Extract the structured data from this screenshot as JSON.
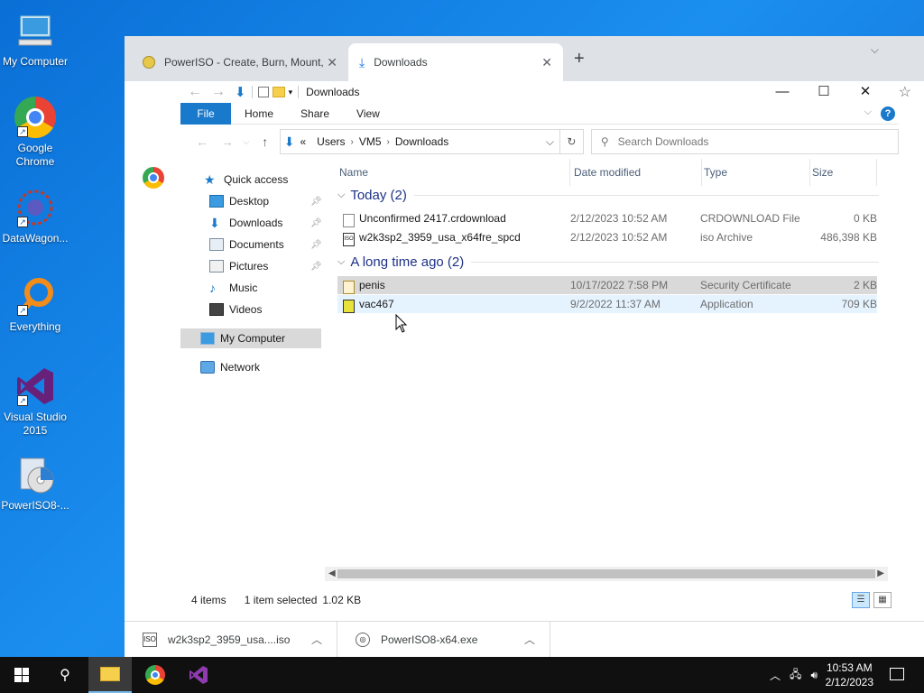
{
  "desktop": {
    "icons": [
      {
        "label": "My Computer"
      },
      {
        "label": "Google Chrome"
      },
      {
        "label": "DataWagon..."
      },
      {
        "label": "Everything"
      },
      {
        "label": "Visual Studio 2015"
      },
      {
        "label": "PowerISO8-..."
      }
    ]
  },
  "browser": {
    "tabs": [
      {
        "title": "PowerISO - Create, Burn, Mount,",
        "close": "✕"
      },
      {
        "title": "Downloads",
        "close": "✕"
      }
    ],
    "newtab": "+",
    "dropdown": "⌵",
    "star": "☆"
  },
  "explorer": {
    "title": "Downloads",
    "ribbon": {
      "file": "File",
      "tabs": [
        "Home",
        "Share",
        "View"
      ],
      "help": "?"
    },
    "address": {
      "overflow": "«",
      "crumbs": [
        "Users",
        "VM5",
        "Downloads"
      ]
    },
    "search_placeholder": "Search Downloads",
    "nav": [
      {
        "label": "Quick access"
      },
      {
        "label": "Desktop"
      },
      {
        "label": "Downloads"
      },
      {
        "label": "Documents"
      },
      {
        "label": "Pictures"
      },
      {
        "label": "Music"
      },
      {
        "label": "Videos"
      },
      {
        "label": "My Computer"
      },
      {
        "label": "Network"
      }
    ],
    "columns": {
      "name": "Name",
      "date": "Date modified",
      "type": "Type",
      "size": "Size"
    },
    "groups": [
      {
        "label": "Today (2)",
        "files": [
          {
            "name": "Unconfirmed 2417.crdownload",
            "date": "2/12/2023 10:52 AM",
            "type": "CRDOWNLOAD File",
            "size": "0 KB"
          },
          {
            "name": "w2k3sp2_3959_usa_x64fre_spcd",
            "date": "2/12/2023 10:52 AM",
            "type": "iso Archive",
            "size": "486,398 KB"
          }
        ]
      },
      {
        "label": "A long time ago (2)",
        "files": [
          {
            "name": "penis",
            "date": "10/17/2022 7:58 PM",
            "type": "Security Certificate",
            "size": "2 KB"
          },
          {
            "name": "vac467",
            "date": "9/2/2022 11:37 AM",
            "type": "Application",
            "size": "709 KB"
          }
        ]
      }
    ],
    "status": {
      "items": "4 items",
      "selected": "1 item selected",
      "size": "1.02 KB"
    }
  },
  "downloads_bar": [
    {
      "name": "w2k3sp2_3959_usa....iso"
    },
    {
      "name": "PowerISO8-x64.exe"
    }
  ],
  "taskbar": {
    "time": "10:53 AM",
    "date": "2/12/2023"
  }
}
